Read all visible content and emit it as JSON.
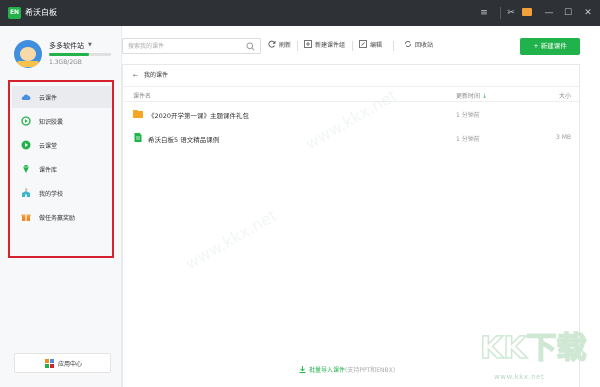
{
  "app": {
    "title": "希沃白板",
    "logo_text": "EN"
  },
  "user": {
    "name": "多多软件站",
    "storage": "1.3GB/2GB",
    "storage_fraction": 0.65
  },
  "nav": {
    "items": [
      {
        "label": "云课件",
        "icon": "cloud-icon",
        "color": "#4a90e2",
        "active": true
      },
      {
        "label": "知识胶囊",
        "icon": "capsule-icon",
        "color": "#21b24b",
        "active": false
      },
      {
        "label": "云课堂",
        "icon": "play-circle-icon",
        "color": "#21b24b",
        "active": false
      },
      {
        "label": "课件库",
        "icon": "diamond-icon",
        "color": "#21b24b",
        "active": false
      },
      {
        "label": "我的学校",
        "icon": "school-icon",
        "color": "#3fb5c8",
        "active": false
      },
      {
        "label": "做任务赢奖励",
        "icon": "gift-icon",
        "color": "#f08a24",
        "active": false
      }
    ]
  },
  "app_center": {
    "label": "应用中心"
  },
  "toolbar": {
    "search_placeholder": "搜索我的课件",
    "refresh": "刷新",
    "new_group": "新建课件组",
    "edit": "编辑",
    "recycle": "回收站",
    "new_courseware": "+ 新建课件"
  },
  "breadcrumb": {
    "label": "我的课件"
  },
  "list": {
    "headers": {
      "name": "课件名",
      "time": "更新时间",
      "size": "大小"
    },
    "rows": [
      {
        "type": "folder",
        "name": "《2020开学第一课》主题课件礼包",
        "time": "1 分钟前",
        "size": ""
      },
      {
        "type": "file",
        "name": "希沃白板5 语文精品课例",
        "time": "1 分钟前",
        "size": "3 MB"
      }
    ]
  },
  "footer": {
    "import_label": "批量导入课件",
    "import_hint": "(支持PPT和ENBX)"
  },
  "watermark": {
    "brand": "KK下载",
    "url": "www.kkx.net"
  },
  "colors": {
    "accent": "#21b24b",
    "titlebar": "#2e3237",
    "highlight_border": "#d4232c"
  }
}
